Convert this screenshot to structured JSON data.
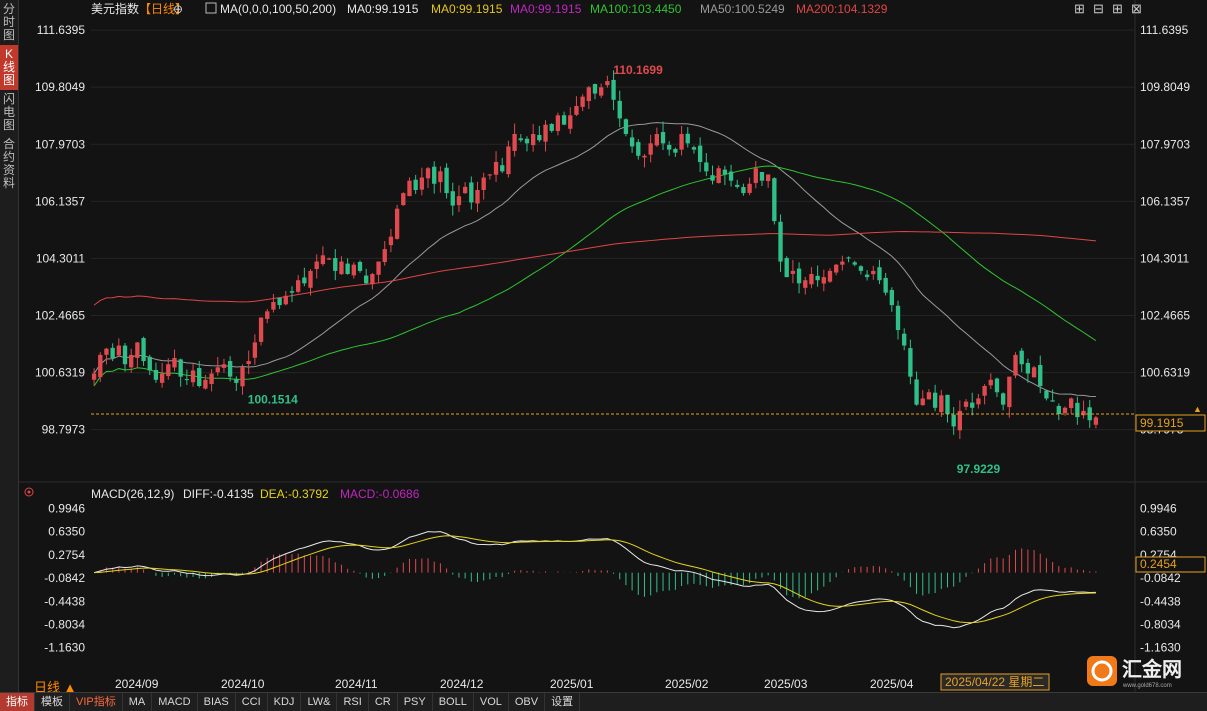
{
  "sidebar": {
    "tabs": [
      {
        "label": "分时图",
        "active": false
      },
      {
        "label": "K线图",
        "active": true
      },
      {
        "label": "闪电图",
        "active": false
      },
      {
        "label": "合约资料",
        "active": false
      }
    ]
  },
  "header": {
    "instrument": "美元指数",
    "period": "【日线】",
    "ma_label": "MA(0,0,0,100,50,200)",
    "ma_values": [
      {
        "text": "MA0:99.1915",
        "color": "#e8e8e8"
      },
      {
        "text": "MA0:99.1915",
        "color": "#e6c619"
      },
      {
        "text": "MA0:99.1915",
        "color": "#c026c0"
      },
      {
        "text": "MA100:103.4450",
        "color": "#2ec52e"
      },
      {
        "text": "MA50:100.5249",
        "color": "#9a9a9a"
      },
      {
        "text": "MA200:104.1329",
        "color": "#e04545"
      }
    ]
  },
  "window_controls": [
    "⊞",
    "⊟",
    "⊞",
    "⊠"
  ],
  "price_axis": [
    "111.6395",
    "109.8049",
    "107.9703",
    "106.1357",
    "104.3011",
    "102.4665",
    "100.6319",
    "98.7973"
  ],
  "current_price": "99.1915",
  "annotations": {
    "high": "110.1699",
    "low_left": "100.1514",
    "low_right": "97.9229"
  },
  "macd": {
    "label": "MACD(26,12,9)",
    "diff": "DIFF:-0.4135",
    "dea": "DEA:-0.3792",
    "macd": "MACD:-0.0686",
    "axis": [
      "0.9946",
      "0.6350",
      "0.2754",
      "-0.0842",
      "-0.4438",
      "-0.8034",
      "-1.1630"
    ],
    "cursor_value": "0.2454"
  },
  "date_axis": [
    "2024/09",
    "2024/10",
    "2024/11",
    "2024/12",
    "2025/01",
    "2025/02",
    "2025/03",
    "2025/04"
  ],
  "cursor_date": "2025/04/22 星期二",
  "period_label": "日线 ▲",
  "bottom_tabs": [
    {
      "label": "指标",
      "active": true,
      "vip": false
    },
    {
      "label": "模板",
      "active": false,
      "vip": false
    },
    {
      "label": "VIP指标",
      "active": false,
      "vip": true
    },
    {
      "label": "MA",
      "active": false,
      "vip": false
    },
    {
      "label": "MACD",
      "active": false,
      "vip": false
    },
    {
      "label": "BIAS",
      "active": false,
      "vip": false
    },
    {
      "label": "CCI",
      "active": false,
      "vip": false
    },
    {
      "label": "KDJ",
      "active": false,
      "vip": false
    },
    {
      "label": "LW&",
      "active": false,
      "vip": false
    },
    {
      "label": "RSI",
      "active": false,
      "vip": false
    },
    {
      "label": "CR",
      "active": false,
      "vip": false
    },
    {
      "label": "PSY",
      "active": false,
      "vip": false
    },
    {
      "label": "BOLL",
      "active": false,
      "vip": false
    },
    {
      "label": "VOL",
      "active": false,
      "vip": false
    },
    {
      "label": "OBV",
      "active": false,
      "vip": false
    },
    {
      "label": "设置",
      "active": false,
      "vip": false
    }
  ],
  "logo": {
    "text": "汇金网",
    "url_text": "www.gold678.com"
  },
  "colors": {
    "up": "#e0494e",
    "down": "#2fc08a",
    "ma50": "#9a9a9a",
    "ma100": "#2ec52e",
    "ma200": "#e04545",
    "dea": "#e6d419",
    "diff": "#e8e8e8",
    "price_box": "#e8a020"
  },
  "chart_data": {
    "type": "candlestick",
    "title": "美元指数 日线",
    "ylim": [
      97.5,
      111.9
    ],
    "closes": [
      100.6,
      101.2,
      101.4,
      101.1,
      101.5,
      100.9,
      101.2,
      101.6,
      101.0,
      100.7,
      100.4,
      100.6,
      100.9,
      101.1,
      100.5,
      100.4,
      100.7,
      100.2,
      100.4,
      100.6,
      100.8,
      100.9,
      100.5,
      100.3,
      100.8,
      101.0,
      101.6,
      102.4,
      102.6,
      102.9,
      102.8,
      103.1,
      103.2,
      103.6,
      103.5,
      103.9,
      104.2,
      104.4,
      104.3,
      103.9,
      104.2,
      103.8,
      104.1,
      103.9,
      103.5,
      103.8,
      104.2,
      104.6,
      105.0,
      105.9,
      106.4,
      106.8,
      106.5,
      106.9,
      107.2,
      106.7,
      107.1,
      106.4,
      106.0,
      106.3,
      106.6,
      106.1,
      106.5,
      106.9,
      107.0,
      107.4,
      107.1,
      107.9,
      108.3,
      108.1,
      108.0,
      108.3,
      108.1,
      108.6,
      108.4,
      108.9,
      108.6,
      108.9,
      109.2,
      109.5,
      109.8,
      109.6,
      109.8,
      110.0,
      109.4,
      108.8,
      108.3,
      107.9,
      107.6,
      107.6,
      108.0,
      108.3,
      108.0,
      107.8,
      107.7,
      108.3,
      108.0,
      107.8,
      107.4,
      107.1,
      106.8,
      107.2,
      107.0,
      106.8,
      106.6,
      106.4,
      106.7,
      107.2,
      106.8,
      107.0,
      105.5,
      104.2,
      103.7,
      103.9,
      103.5,
      103.6,
      103.8,
      103.6,
      103.7,
      103.9,
      104.1,
      104.2,
      104.3,
      104.1,
      103.9,
      103.7,
      103.9,
      103.6,
      103.2,
      102.8,
      102.0,
      101.5,
      100.5,
      99.6,
      99.8,
      100.0,
      99.5,
      99.9,
      99.3,
      98.9,
      99.4,
      99.7,
      99.5,
      99.8,
      100.2,
      100.4,
      100.0,
      99.6,
      100.5,
      101.2,
      100.9,
      100.6,
      100.8,
      100.2,
      99.8,
      99.7,
      99.3,
      99.5,
      99.8,
      99.2,
      99.4,
      99.1,
      99.19
    ]
  }
}
